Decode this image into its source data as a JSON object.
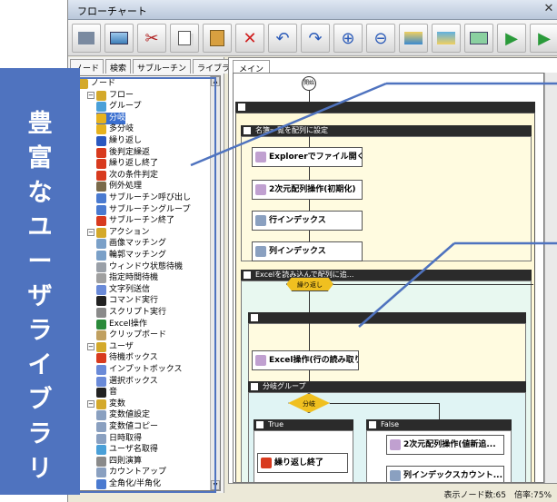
{
  "window": {
    "title": "フローチャート",
    "close_icon": "close-icon"
  },
  "toolbar": {
    "buttons": [
      {
        "name": "chart-icon"
      },
      {
        "name": "image-icon"
      },
      {
        "name": "cut-icon"
      },
      {
        "name": "copy-icon"
      },
      {
        "name": "paste-icon"
      },
      {
        "name": "delete-icon"
      },
      {
        "name": "undo-icon"
      },
      {
        "name": "redo-icon"
      },
      {
        "name": "zoom-in-icon"
      },
      {
        "name": "zoom-out-icon"
      },
      {
        "name": "export-icon"
      },
      {
        "name": "import-icon"
      },
      {
        "name": "monitor-icon"
      },
      {
        "name": "run-icon"
      },
      {
        "name": "next-icon"
      }
    ]
  },
  "left_panel": {
    "tabs": [
      "ノード",
      "検索",
      "サブルーチン",
      "ライブラリ"
    ],
    "tree": [
      {
        "label": "ノード",
        "level": 0,
        "color": "#d4a92a",
        "pm": ""
      },
      {
        "label": "フロー",
        "level": 1,
        "color": "#d4a92a",
        "pm": "−"
      },
      {
        "label": "グループ",
        "level": 2,
        "color": "#4aa0d8"
      },
      {
        "label": "分岐",
        "level": 2,
        "color": "#e6b21e",
        "selected": true
      },
      {
        "label": "多分岐",
        "level": 2,
        "color": "#e6b21e"
      },
      {
        "label": "繰り返し",
        "level": 2,
        "color": "#2a58c0"
      },
      {
        "label": "後判定繰返",
        "level": 2,
        "color": "#d83a1e"
      },
      {
        "label": "繰り返し終了",
        "level": 2,
        "color": "#d83a1e"
      },
      {
        "label": "次の条件判定",
        "level": 2,
        "color": "#d83a1e"
      },
      {
        "label": "例外処理",
        "level": 2,
        "color": "#7a6a4a"
      },
      {
        "label": "サブルーチン呼び出し",
        "level": 2,
        "color": "#4a7ad0"
      },
      {
        "label": "サブルーチングループ",
        "level": 2,
        "color": "#4a7ad0"
      },
      {
        "label": "サブルーチン終了",
        "level": 2,
        "color": "#d83a1e"
      },
      {
        "label": "アクション",
        "level": 1,
        "color": "#d4a92a",
        "pm": "−"
      },
      {
        "label": "画像マッチング",
        "level": 2,
        "color": "#7aa0c8"
      },
      {
        "label": "輪郭マッチング",
        "level": 2,
        "color": "#7aa0c8"
      },
      {
        "label": "ウィンドウ状態待機",
        "level": 2,
        "color": "#9aa0a8"
      },
      {
        "label": "指定時間待機",
        "level": 2,
        "color": "#a0a0a0"
      },
      {
        "label": "文字列送信",
        "level": 2,
        "color": "#6a8ad8"
      },
      {
        "label": "コマンド実行",
        "level": 2,
        "color": "#222222"
      },
      {
        "label": "スクリプト実行",
        "level": 2,
        "color": "#8a8a8a"
      },
      {
        "label": "Excel操作",
        "level": 2,
        "color": "#2a8a3a"
      },
      {
        "label": "クリップボード",
        "level": 2,
        "color": "#c0a060"
      },
      {
        "label": "ユーザ",
        "level": 1,
        "color": "#d4a92a",
        "pm": "−"
      },
      {
        "label": "待機ボックス",
        "level": 2,
        "color": "#d83a1e"
      },
      {
        "label": "インプットボックス",
        "level": 2,
        "color": "#6a8ad8"
      },
      {
        "label": "選択ボックス",
        "level": 2,
        "color": "#6a8ad8"
      },
      {
        "label": "音",
        "level": 2,
        "color": "#222222"
      },
      {
        "label": "変数",
        "level": 1,
        "color": "#d4a92a",
        "pm": "−"
      },
      {
        "label": "変数値設定",
        "level": 2,
        "color": "#8aa0c0"
      },
      {
        "label": "変数値コピー",
        "level": 2,
        "color": "#8aa0c0"
      },
      {
        "label": "日時取得",
        "level": 2,
        "color": "#8aa0c0"
      },
      {
        "label": "ユーザ名取得",
        "level": 2,
        "color": "#4aa0d8"
      },
      {
        "label": "四則演算",
        "level": 2,
        "color": "#8a8a8a"
      },
      {
        "label": "カウントアップ",
        "level": 2,
        "color": "#8aa0c0"
      },
      {
        "label": "全角化/半角化",
        "level": 2,
        "color": "#4a7ad0"
      }
    ]
  },
  "banner": {
    "text": [
      "豊",
      "富",
      "な",
      "ユ",
      "ー",
      "ザ",
      "ラ",
      "イ",
      "ブ",
      "ラ",
      "リ"
    ],
    "color": "#4f73bf"
  },
  "flow": {
    "tab": "メイン",
    "start_label": "開始",
    "group1_head": "",
    "group2_head": "名簿一覧を配列に設定",
    "nodes": [
      "Explorerでファイル開く",
      "2次元配列操作(初期化)",
      "行インデックス",
      "列インデックス"
    ],
    "group3_head": "Excelを読み込んで配列に追...",
    "loop_label": "繰り返し",
    "group4_head": "",
    "excel_node": "Excel操作(行の読み取り",
    "branch_group_head": "分岐グループ",
    "branch_label": "分岐",
    "true_label": "True",
    "false_label": "False",
    "loop_end": "繰り返し終了",
    "array_op": "2次元配列操作(値新追...",
    "col_count": "列インデックスカウント..."
  },
  "status": {
    "text": "表示ノード数:65　倍率:75%"
  }
}
